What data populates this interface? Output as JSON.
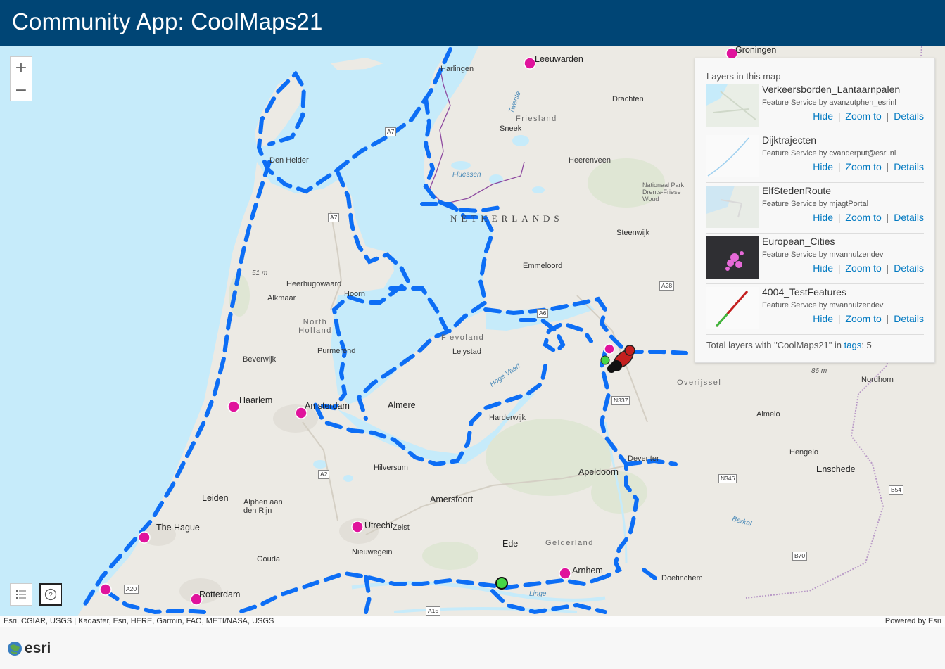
{
  "app": {
    "title": "Community App: CoolMaps21"
  },
  "zoom": {
    "in": "+",
    "out": "−"
  },
  "map": {
    "country": "NETHERLANDS",
    "cities": [
      "Leeuwarden",
      "Groningen",
      "Harlingen",
      "Drachten",
      "Sneek",
      "Heerenveen",
      "Den Helder",
      "Steenwijk",
      "Emmeloord",
      "Heerhugowaard",
      "Hoorn",
      "Alkmaar",
      "Lelystad",
      "Purmerend",
      "Beverwijk",
      "Haarlem",
      "Amsterdam",
      "Almere",
      "Harderwijk",
      "Hilversum",
      "Apeldoorn",
      "Deventer",
      "Almelo",
      "Hengelo",
      "Enschede",
      "Nordhorn",
      "Leiden",
      "Alphen aan den Rijn",
      "The Hague",
      "Utrecht",
      "Zeist",
      "Amersfoort",
      "Nieuwegein",
      "Ede",
      "Gouda",
      "Rotterdam",
      "Arnhem",
      "Doetinchem"
    ],
    "regions": [
      "Friesland",
      "North Holland",
      "Flevoland",
      "Overijssel",
      "Gelderland",
      "Nationaal Park Drents-Friese Woud"
    ],
    "water": [
      "Fluessen",
      "Hoge Vaart",
      "Linge",
      "Berkel",
      "Twente"
    ],
    "roads": [
      "A7",
      "A7",
      "A6",
      "A28",
      "N337",
      "A2",
      "N346",
      "B54",
      "B70",
      "A20",
      "A15"
    ]
  },
  "layers_panel": {
    "heading": "Layers in this map",
    "actions": {
      "hide": "Hide",
      "zoom": "Zoom to",
      "details": "Details",
      "sep": "|"
    },
    "layers": [
      {
        "title": "Verkeersborden_Lantaarnpalen",
        "source": "Feature Service by avanzutphen_esrinl"
      },
      {
        "title": "Dijktrajecten",
        "source": "Feature Service by cvanderput@esri.nl"
      },
      {
        "title": "ElfStedenRoute",
        "source": "Feature Service by mjagtPortal"
      },
      {
        "title": "European_Cities",
        "source": "Feature Service by mvanhulzendev"
      },
      {
        "title": "4004_TestFeatures",
        "source": "Feature Service by mvanhulzendev"
      }
    ],
    "footer_text": "Total layers with \"CoolMaps21\" in",
    "footer_link": "tags",
    "footer_count": ": 5"
  },
  "attribution": {
    "left": "Esri, CGIAR, USGS | Kadaster, Esri, HERE, Garmin, FAO, METI/NASA, USGS",
    "right": "Powered by Esri"
  },
  "footer": {
    "logo": "esri"
  },
  "colors": {
    "header": "#004575",
    "route": "#0d6ef5",
    "city_marker": "#e0139c",
    "water": "#c6ebfa",
    "link": "#0079c1"
  }
}
